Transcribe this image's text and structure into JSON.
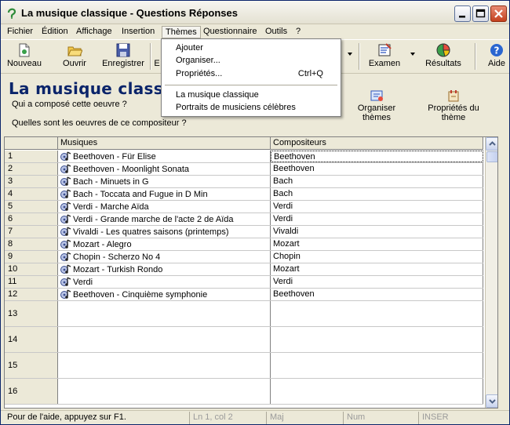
{
  "window": {
    "title": "La musique classique - Questions Réponses"
  },
  "menubar": {
    "items": [
      "Fichier",
      "Édition",
      "Affichage",
      "Insertion",
      "Thèmes",
      "Questionnaire",
      "Outils",
      "?"
    ]
  },
  "toolbar": {
    "nouveau": "Nouveau",
    "ouvrir": "Ouvrir",
    "enregistrer": "Enregistrer",
    "e_partial": "E",
    "examen": "Examen",
    "resultats": "Résultats",
    "aide": "Aide"
  },
  "header": {
    "title": "La musique classique",
    "question1": "Qui a composé cette oeuvre ?",
    "question2": "Quelles sont les oeuvres de ce compositeur ?",
    "organiser": "Organiser thèmes",
    "proprietes": "Propriétés du thème"
  },
  "themes_menu": {
    "ajouter": "Ajouter",
    "organiser": "Organiser...",
    "proprietes": "Propriétés...",
    "proprietes_shortcut": "Ctrl+Q",
    "theme1": "La musique classique",
    "theme2": "Portraits de musiciens célèbres"
  },
  "grid": {
    "col_musiques": "Musiques",
    "col_compositeurs": "Compositeurs",
    "rows": [
      {
        "num": "1",
        "musique": "Beethoven - Für Elise",
        "compositeur": "Beethoven"
      },
      {
        "num": "2",
        "musique": "Beethoven - Moonlight Sonata",
        "compositeur": "Beethoven"
      },
      {
        "num": "3",
        "musique": "Bach - Minuets in G",
        "compositeur": "Bach"
      },
      {
        "num": "4",
        "musique": "Bach - Toccata and Fugue in D Min",
        "compositeur": "Bach"
      },
      {
        "num": "5",
        "musique": "Verdi - Marche Aïda",
        "compositeur": "Verdi"
      },
      {
        "num": "6",
        "musique": "Verdi - Grande marche de l'acte 2 de Aïda",
        "compositeur": "Verdi"
      },
      {
        "num": "7",
        "musique": "Vivaldi - Les quatres saisons (printemps)",
        "compositeur": "Vivaldi"
      },
      {
        "num": "8",
        "musique": "Mozart - Alegro",
        "compositeur": "Mozart"
      },
      {
        "num": "9",
        "musique": "Chopin - Scherzo No 4",
        "compositeur": "Chopin"
      },
      {
        "num": "10",
        "musique": "Mozart - Turkish Rondo",
        "compositeur": "Mozart"
      },
      {
        "num": "11",
        "musique": "Verdi",
        "compositeur": "Verdi"
      },
      {
        "num": "12",
        "musique": "Beethoven - Cinquième symphonie",
        "compositeur": "Beethoven"
      }
    ],
    "empty_rows": [
      "13",
      "14",
      "15",
      "16"
    ]
  },
  "statusbar": {
    "help": "Pour de l'aide, appuyez sur F1.",
    "position": "Ln 1, col 2",
    "maj": "Maj",
    "num": "Num",
    "inser": "INSER"
  }
}
